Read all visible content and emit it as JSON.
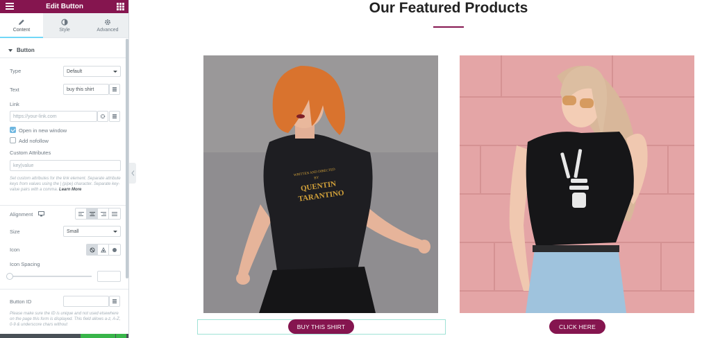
{
  "colors": {
    "brand": "#85154f",
    "accent": "#71d7f7",
    "checked": "#6fb7e0",
    "publish": "#39b54a"
  },
  "panel": {
    "title": "Edit Button",
    "menu_icon": "hamburger-icon",
    "apps_icon": "grid-icon",
    "tabs": [
      {
        "label": "Content",
        "icon": "pencil-icon",
        "active": true
      },
      {
        "label": "Style",
        "icon": "half-circle-icon",
        "active": false
      },
      {
        "label": "Advanced",
        "icon": "gear-icon",
        "active": false
      }
    ],
    "section_title": "Button",
    "type": {
      "label": "Type",
      "value": "Default"
    },
    "text": {
      "label": "Text",
      "value": "buy this shirt"
    },
    "link": {
      "label": "Link",
      "placeholder": "https://your-link.com"
    },
    "open_new_window": {
      "label": "Open in new window",
      "checked": true
    },
    "add_nofollow": {
      "label": "Add nofollow",
      "checked": false
    },
    "custom_attributes": {
      "label": "Custom Attributes",
      "placeholder": "key|value",
      "help": "Set custom attributes for the link element. Separate attribute keys from values using the | (pipe) character. Separate key-value pairs with a comma.",
      "learn_more": "Learn More"
    },
    "alignment": {
      "label": "Alignment",
      "selected": "center"
    },
    "size": {
      "label": "Size",
      "value": "Small"
    },
    "icon": {
      "label": "Icon",
      "selected": "none"
    },
    "icon_spacing": {
      "label": "Icon Spacing",
      "value": ""
    },
    "button_id": {
      "label": "Button ID",
      "value": "",
      "help": "Please make sure the ID is unique and not used elsewhere on the page this form is displayed. This field allows a-z, A-Z, 0-9 & underscore chars without"
    }
  },
  "page": {
    "heading": "Our Featured Products",
    "products": [
      {
        "image": "woman-orange-hair-black-tee",
        "shirt_text": [
          "WRITTEN AND DIRECTED",
          "BY",
          "QUENTIN",
          "TARANTINO"
        ],
        "button": "BUY THIS SHIRT"
      },
      {
        "image": "woman-blonde-skeleton-hand-tee",
        "button": "CLICK HERE"
      }
    ]
  }
}
